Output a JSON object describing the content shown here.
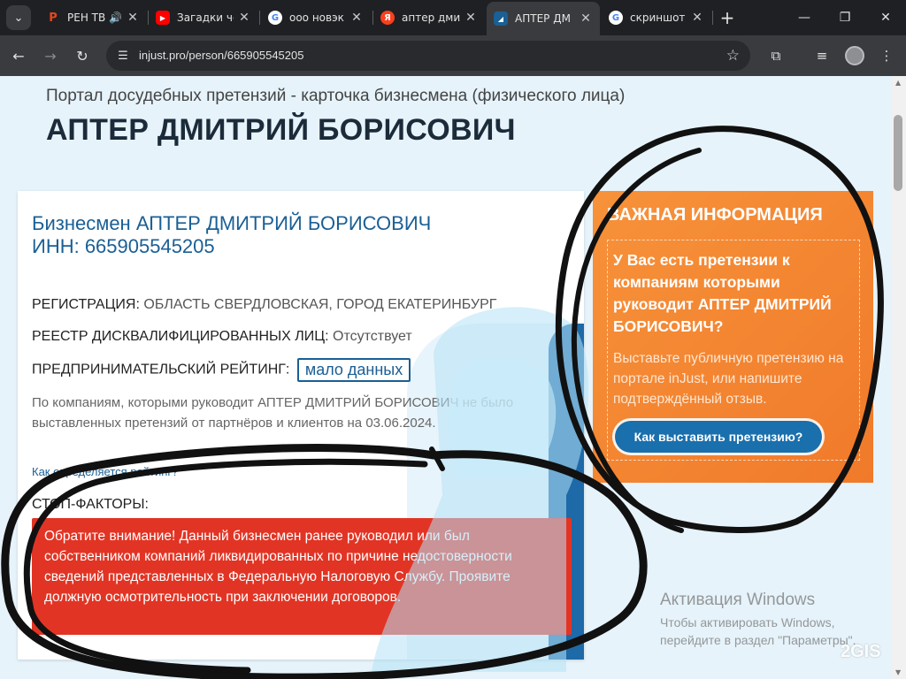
{
  "browser": {
    "tabs": [
      {
        "title": "РЕН ТВ",
        "favicon": "ren-tv-icon",
        "color": "#e8461c",
        "audio": true
      },
      {
        "title": "Загадки че",
        "favicon": "youtube-icon",
        "color": "#ff0000"
      },
      {
        "title": "ооо новэк",
        "favicon": "google-icon",
        "color": "#4285f4"
      },
      {
        "title": "аптер дми",
        "favicon": "yandex-icon",
        "color": "#fc3f1d"
      },
      {
        "title": "АПТЕР ДМ",
        "favicon": "injust-icon",
        "color": "#1a5f95",
        "active": true
      },
      {
        "title": "скриншот",
        "favicon": "google-icon",
        "color": "#4285f4"
      }
    ],
    "url": "injust.pro/person/665905545205"
  },
  "page": {
    "subtitle": "Портал досудебных претензий - карточка бизнесмена (физического лица)",
    "title": "АПТЕР ДМИТРИЙ БОРИСОВИЧ"
  },
  "card": {
    "name_line": "Бизнесмен АПТЕР ДМИТРИЙ БОРИСОВИЧ",
    "inn_line": "ИНН: 665905545205",
    "registration_label": "РЕГИСТРАЦИЯ:",
    "registration_value": "ОБЛАСТЬ СВЕРДЛОВСКАЯ, ГОРОД ЕКАТЕРИНБУРГ",
    "disq_label": "РЕЕСТР ДИСКВАЛИФИЦИРОВАННЫХ ЛИЦ:",
    "disq_value": "Отсутствует",
    "rating_label": "ПРЕДПРИНИМАТЕЛЬСКИЙ РЕЙТИНГ:",
    "rating_value": "мало данных",
    "note": "По компаниям, которыми руководит АПТЕР ДМИТРИЙ БОРИСОВИЧ не было выставленных претензий от партнёров и клиентов на 03.06.2024.",
    "rating_link": "Как определяется рейтинг?",
    "stop_label": "СТОП-ФАКТОРЫ:",
    "alert": "Обратите внимание! Данный бизнесмен ранее руководил или был собственником компаний ликвидированных по причине недостоверности сведений представленных в Федеральную Налоговую Службу. Проявите должную осмотрительность при заключении договоров."
  },
  "info": {
    "title": "ВАЖНАЯ ИНФОРМАЦИЯ",
    "question": "У Вас есть претензии к компаниям которыми руководит АПТЕР ДМИТРИЙ БОРИСОВИЧ?",
    "text": "Выставьте публичную претензию на портале inJust, или напишите подтверждённый отзыв.",
    "button": "Как выставить претензию?"
  },
  "watermark": {
    "title": "Активация Windows",
    "sub": "Чтобы активировать Windows, перейдите в раздел \"Параметры\"."
  },
  "overlay_logo": "2GIS",
  "colors": {
    "accent_blue": "#1a5f95",
    "info_orange": "#f7923a",
    "alert_red": "#e23424"
  }
}
